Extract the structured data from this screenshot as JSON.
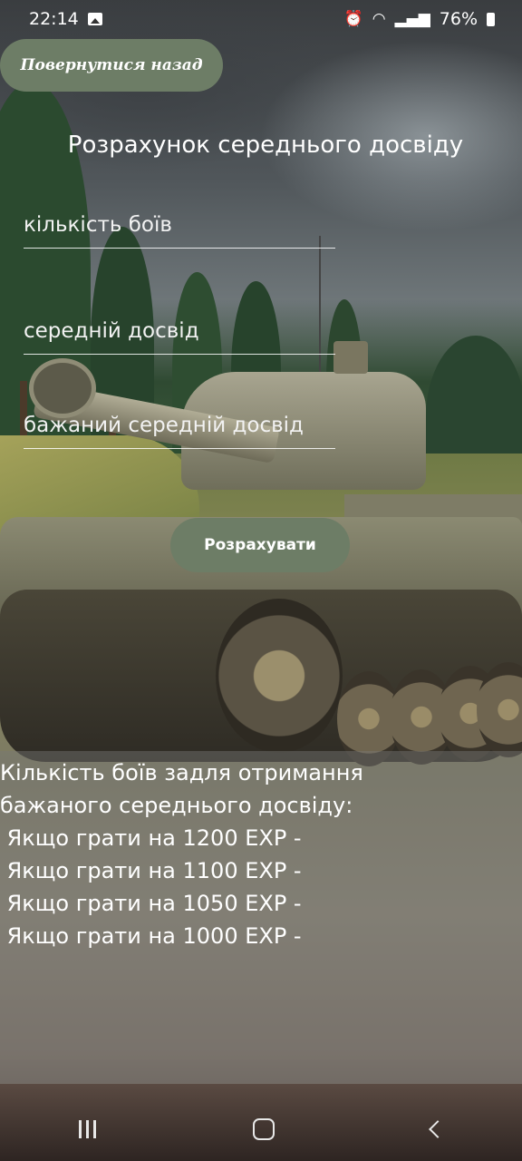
{
  "status_bar": {
    "time": "22:14",
    "battery": "76%",
    "icons": [
      "image-icon",
      "alarm-icon",
      "wifi-icon",
      "signal-icon",
      "battery-icon"
    ]
  },
  "header": {
    "back_button_label": "Повернутися назад",
    "title": "Розрахунок середнього досвіду"
  },
  "form": {
    "battles_placeholder": "кількість боїв",
    "avg_exp_placeholder": "середній досвід",
    "target_avg_exp_placeholder": "бажаний середній досвід",
    "calculate_label": "Розрахувати"
  },
  "result": {
    "heading_line1": "Кількість боїв задля отримання",
    "heading_line2": "бажаного середнього досвіду:",
    "rows": [
      " Якщо грати на 1200 EXP -",
      " Якщо грати на 1100 EXP -",
      " Якщо грати на 1050 EXP -",
      " Якщо грати на 1000 EXP -"
    ]
  },
  "nav": {
    "items": [
      "recent-apps",
      "home",
      "back"
    ]
  },
  "colors": {
    "button_bg": "#6d7d66",
    "text": "#ffffff"
  }
}
